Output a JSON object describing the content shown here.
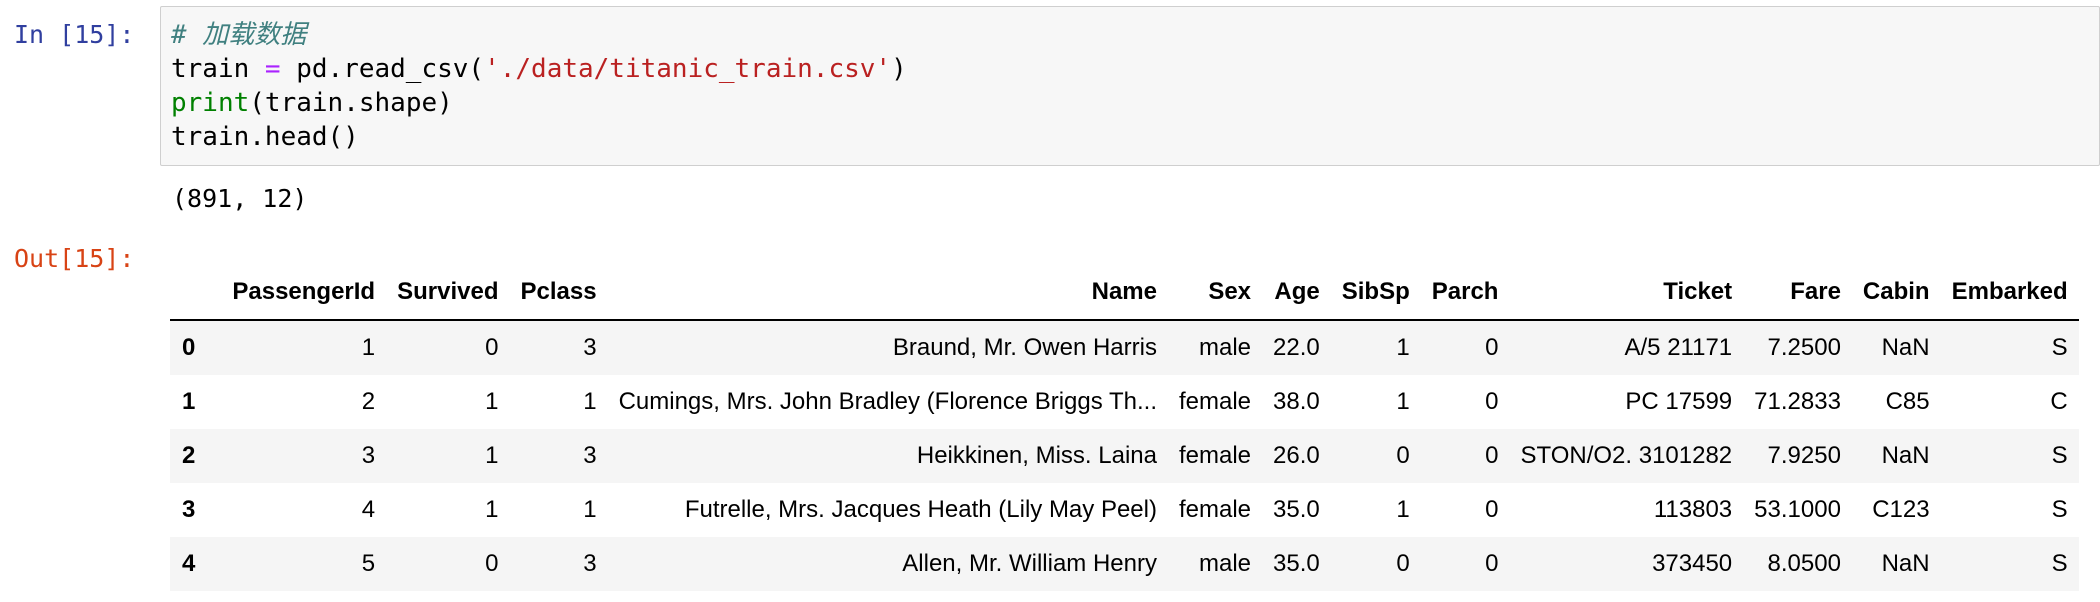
{
  "in_prompt": "In [15]:",
  "out_prompt": "Out[15]:",
  "code": {
    "line1_comment": "# 加载数据",
    "line2_var": "train ",
    "line2_op": "=",
    "line2_mid": " pd.read_csv(",
    "line2_str": "'./data/titanic_train.csv'",
    "line2_end": ")",
    "line3_builtin": "print",
    "line3_rest": "(train.shape)",
    "line4": "train.head()"
  },
  "stdout": "(891, 12)",
  "table": {
    "columns": [
      "",
      "PassengerId",
      "Survived",
      "Pclass",
      "Name",
      "Sex",
      "Age",
      "SibSp",
      "Parch",
      "Ticket",
      "Fare",
      "Cabin",
      "Embarked"
    ],
    "rows": [
      [
        "0",
        "1",
        "0",
        "3",
        "Braund, Mr. Owen Harris",
        "male",
        "22.0",
        "1",
        "0",
        "A/5 21171",
        "7.2500",
        "NaN",
        "S"
      ],
      [
        "1",
        "2",
        "1",
        "1",
        "Cumings, Mrs. John Bradley (Florence Briggs Th...",
        "female",
        "38.0",
        "1",
        "0",
        "PC 17599",
        "71.2833",
        "C85",
        "C"
      ],
      [
        "2",
        "3",
        "1",
        "3",
        "Heikkinen, Miss. Laina",
        "female",
        "26.0",
        "0",
        "0",
        "STON/O2. 3101282",
        "7.9250",
        "NaN",
        "S"
      ],
      [
        "3",
        "4",
        "1",
        "1",
        "Futrelle, Mrs. Jacques Heath (Lily May Peel)",
        "female",
        "35.0",
        "1",
        "0",
        "113803",
        "53.1000",
        "C123",
        "S"
      ],
      [
        "4",
        "5",
        "0",
        "3",
        "Allen, Mr. William Henry",
        "male",
        "35.0",
        "0",
        "0",
        "373450",
        "8.0500",
        "NaN",
        "S"
      ]
    ]
  }
}
